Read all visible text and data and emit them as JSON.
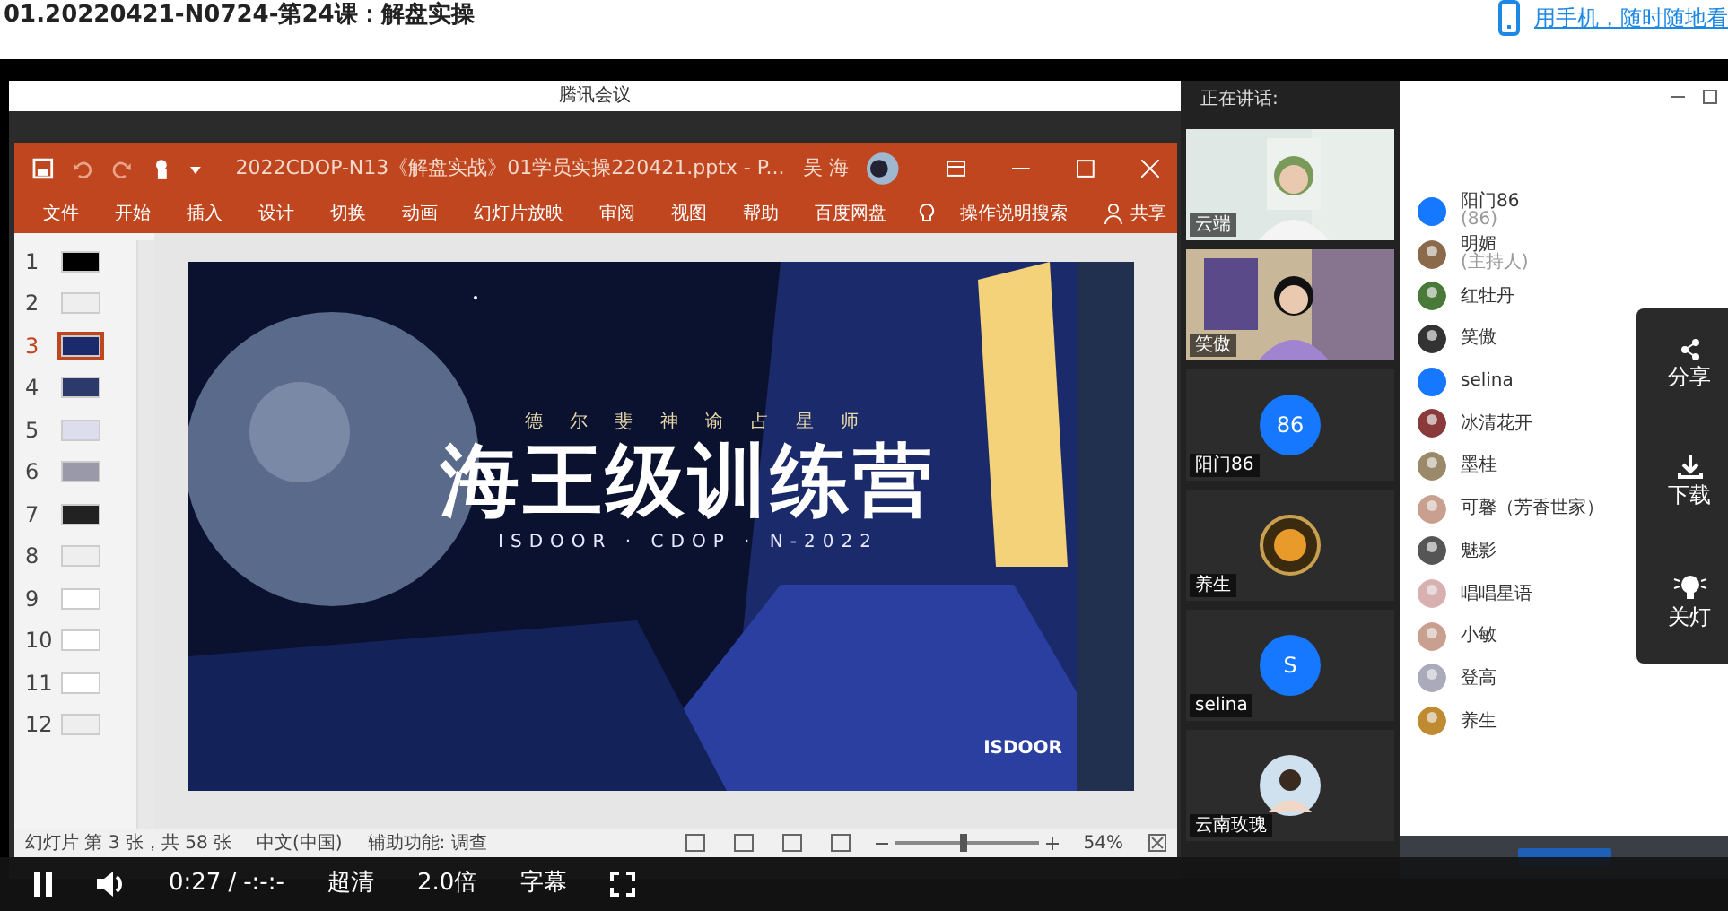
{
  "page": {
    "title": "01.20220421-N0724-第24课：解盘实操",
    "mobile_link": "用手机，随时随地看"
  },
  "meeting": {
    "title": "腾讯会议",
    "speaking_label": "正在讲话:"
  },
  "ppt": {
    "file_title": "2022CDOP-N13《解盘实战》01学员实操220421.pptx  -  P...",
    "user": "吴 海",
    "ribbon": [
      "文件",
      "开始",
      "插入",
      "设计",
      "切换",
      "动画",
      "幻灯片放映",
      "审阅",
      "视图",
      "帮助",
      "百度网盘"
    ],
    "tell_me": "操作说明搜索",
    "share": "共享",
    "slides": [
      {
        "number": "1",
        "selected": false
      },
      {
        "number": "2",
        "selected": false
      },
      {
        "number": "3",
        "selected": true
      },
      {
        "number": "4",
        "selected": false
      },
      {
        "number": "5",
        "selected": false
      },
      {
        "number": "6",
        "selected": false
      },
      {
        "number": "7",
        "selected": false
      },
      {
        "number": "8",
        "selected": false
      },
      {
        "number": "9",
        "selected": false
      },
      {
        "number": "10",
        "selected": false
      },
      {
        "number": "11",
        "selected": false
      },
      {
        "number": "12",
        "selected": false
      }
    ],
    "slide": {
      "subtitle": "德 尔 斐 神 谕 占 星 师",
      "title": "海王级训练营",
      "tagline": "ISDOOR · CDOP · N-2022",
      "brand": "ISDOOR"
    },
    "status": {
      "slide_info": "幻灯片 第 3 张，共 58 张",
      "language": "中文(中国)",
      "accessibility": "辅助功能: 调查",
      "zoom": "54%",
      "level": 0.45
    }
  },
  "video_tiles": [
    {
      "kind": "picture",
      "name": "云端"
    },
    {
      "kind": "picture",
      "name": "笑傲"
    },
    {
      "kind": "initials",
      "initials": "86",
      "name": "阳门86"
    },
    {
      "kind": "logo",
      "name": "养生"
    },
    {
      "kind": "initials",
      "initials": "S",
      "name": "selina"
    },
    {
      "kind": "avatar",
      "name": "云南玫瑰"
    }
  ],
  "participants": [
    {
      "kind": "initials",
      "name": "阳门86",
      "note": "(86)"
    },
    {
      "name": "明媚",
      "note": "(主持人)"
    },
    {
      "name": "红牡丹"
    },
    {
      "name": "笑傲"
    },
    {
      "kind": "initials",
      "name": "selina"
    },
    {
      "name": "冰清花开"
    },
    {
      "name": "墨桂"
    },
    {
      "name": "可馨（芳香世家）"
    },
    {
      "name": "魅影"
    },
    {
      "name": "唱唱星语"
    },
    {
      "name": "小敏"
    },
    {
      "name": "登高"
    },
    {
      "name": "养生"
    }
  ],
  "side_menu": [
    {
      "kind": "share",
      "label": "分享"
    },
    {
      "kind": "download",
      "label": "下载"
    },
    {
      "kind": "light",
      "label": "关灯"
    }
  ],
  "player": {
    "playing": true,
    "time": "0:27",
    "separator": "/",
    "duration": "-:-:-",
    "quality": "超清",
    "speed": "2.0倍",
    "subtitles": "字幕"
  }
}
